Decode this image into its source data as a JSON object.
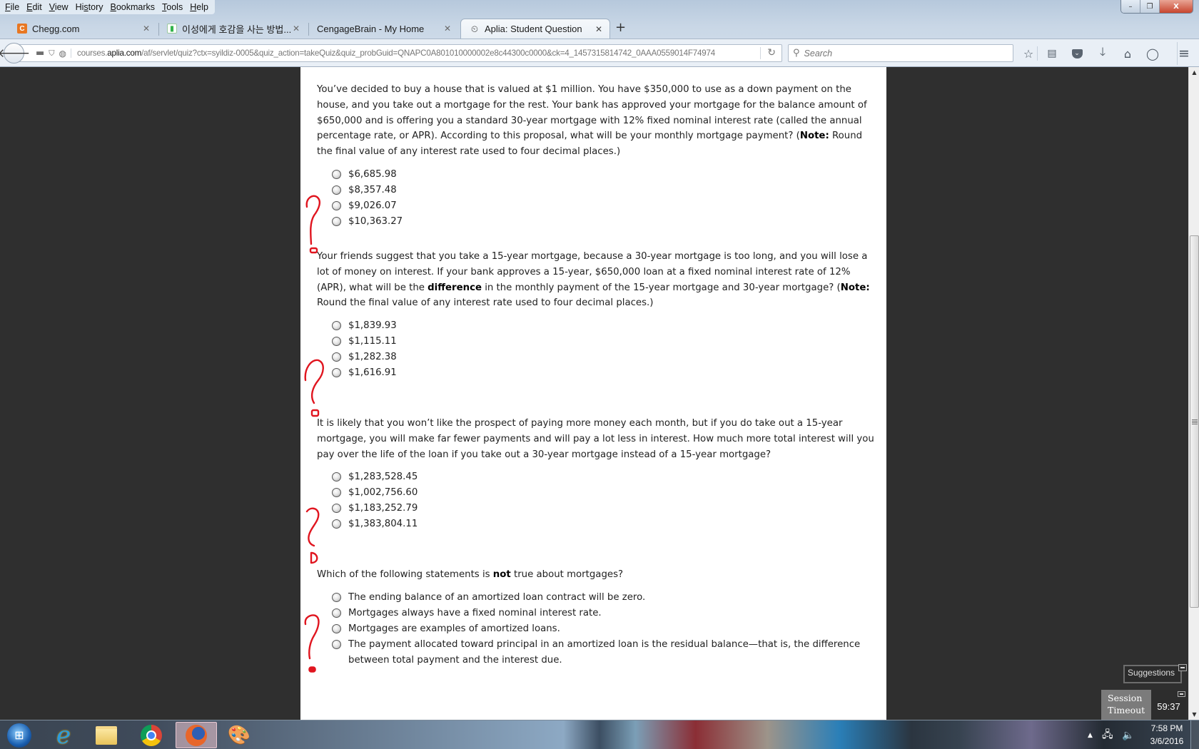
{
  "browser": {
    "menu": [
      {
        "label": "File",
        "key": "F"
      },
      {
        "label": "Edit",
        "key": "E"
      },
      {
        "label": "View",
        "key": "V"
      },
      {
        "label": "History",
        "key": "s"
      },
      {
        "label": "Bookmarks",
        "key": "B"
      },
      {
        "label": "Tools",
        "key": "T"
      },
      {
        "label": "Help",
        "key": "H"
      }
    ],
    "window_controls": {
      "minimize": "–",
      "restore": "❐",
      "close": "X"
    },
    "tabs": [
      {
        "title": "Chegg.com",
        "favicon": "chegg-icon",
        "favicon_color": "#e87722",
        "favicon_glyph": "C",
        "active": false
      },
      {
        "title": "이성에게 호감을 사는 방법...",
        "favicon": "naver-blog-icon",
        "favicon_color": "#32b44a",
        "favicon_glyph": "▮",
        "active": false
      },
      {
        "title": "CengageBrain - My Home",
        "favicon": "",
        "active": false
      },
      {
        "title": "Aplia: Student Question",
        "favicon": "aplia-icon",
        "favicon_glyph": "⏲",
        "active": true
      }
    ],
    "tab_close_glyph": "✕",
    "new_tab_glyph": "+",
    "url": {
      "prefix": "courses.",
      "domain": "aplia.com",
      "path": "/af/servlet/quiz?ctx=syildiz-0005&quiz_action=takeQuiz&quiz_probGuid=QNAPC0A801010000002e8c44300c0000&ck=4_1457315814742_0AAA0559014F74974"
    },
    "search_placeholder": "Search"
  },
  "quiz": {
    "questions": [
      {
        "text_parts": [
          {
            "t": "You’ve decided to buy a house that is valued at $1 million. You have $350,000 to use as a down payment on the house, and you take out a mortgage for the rest. Your bank has approved your mortgage for the balance amount of $650,000 and is offering you a standard 30-year mortgage with 12% fixed nominal interest rate (called the annual percentage rate, or APR). According to this proposal, what will be your monthly mortgage payment? ("
          },
          {
            "t": "Note:",
            "bold": true
          },
          {
            "t": " Round the final value of any interest rate used to four decimal places.)"
          }
        ],
        "options": [
          "$6,685.98",
          "$8,357.48",
          "$9,026.07",
          "$10,363.27"
        ],
        "selected": null
      },
      {
        "text_parts": [
          {
            "t": "Your friends suggest that you take a 15-year mortgage, because a 30-year mortgage is too long, and you will lose a lot of money on interest. If your bank approves a 15-year, $650,000 loan at a fixed nominal interest rate of 12% (APR), what will be the "
          },
          {
            "t": "difference",
            "bold": true
          },
          {
            "t": " in the monthly payment of the 15-year mortgage and 30-year mortgage? ("
          },
          {
            "t": "Note:",
            "bold": true
          },
          {
            "t": " Round the final value of any interest rate used to four decimal places.)"
          }
        ],
        "options": [
          "$1,839.93",
          "$1,115.11",
          "$1,282.38",
          "$1,616.91"
        ],
        "selected": null
      },
      {
        "text_parts": [
          {
            "t": "It is likely that you won’t like the prospect of paying more money each month, but if you do take out a 15-year mortgage, you will make far fewer payments and will pay a lot less in interest. How much more total interest will you pay over the life of the loan if you take out a 30-year mortgage instead of a 15-year mortgage?"
          }
        ],
        "options": [
          "$1,283,528.45",
          "$1,002,756.60",
          "$1,183,252.79",
          "$1,383,804.11"
        ],
        "selected": null
      },
      {
        "text_parts": [
          {
            "t": "Which of the following statements is "
          },
          {
            "t": "not",
            "bold": true
          },
          {
            "t": " true about mortgages?"
          }
        ],
        "options": [
          "The ending balance of an amortized loan contract will be zero.",
          "Mortgages always have a fixed nominal interest rate.",
          "Mortgages are examples of amortized loans.",
          "The payment allocated toward principal in an amortized loan is the residual balance—that is, the difference between total payment and the interest due."
        ],
        "selected": null
      }
    ],
    "annotation_color": "#e0151f"
  },
  "widgets": {
    "suggestions_label": "Suggestions",
    "session_label_line1": "Session",
    "session_label_line2": "Timeout",
    "session_time": "59:37"
  },
  "scrollbar": {
    "thumb_start_fraction": 0.25,
    "thumb_visible_fraction": 0.59
  },
  "taskbar": {
    "apps": [
      {
        "name": "start-button",
        "glyph": "⊞",
        "color": "#3a8fd8"
      },
      {
        "name": "internet-explorer-icon",
        "glyph": "e",
        "color": "#2a9be0"
      },
      {
        "name": "file-explorer-icon",
        "glyph": "▤",
        "color": "#f1d37a"
      },
      {
        "name": "chrome-icon",
        "glyph": "●",
        "color": "#3f7ee8"
      },
      {
        "name": "firefox-icon",
        "glyph": "◕",
        "color": "#e8662a",
        "active": true
      },
      {
        "name": "paint-icon",
        "glyph": "🎨",
        "color": "#d8d8d8"
      }
    ],
    "clock_time": "7:58 PM",
    "clock_date": "3/6/2016"
  }
}
